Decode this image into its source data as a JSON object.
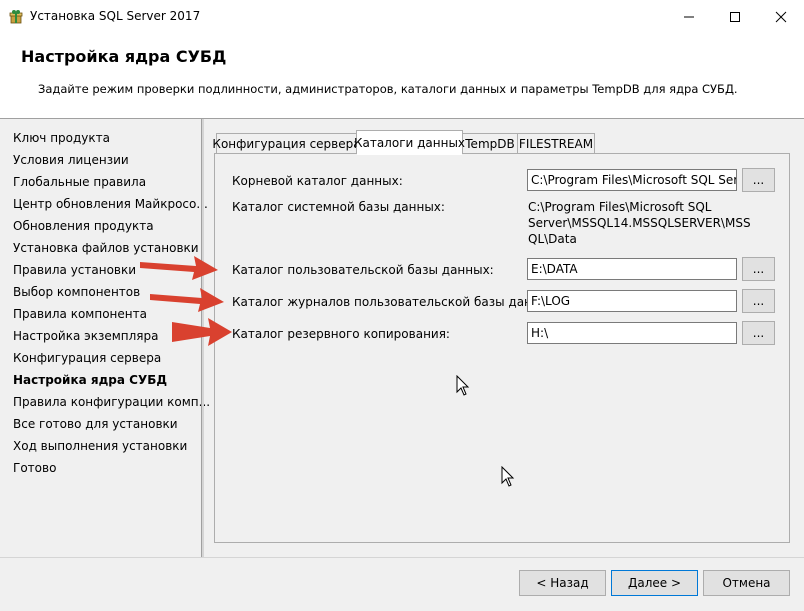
{
  "window": {
    "title": "Установка SQL Server 2017",
    "minimize_icon": "minimize-icon",
    "maximize_icon": "maximize-icon",
    "close_icon": "close-icon"
  },
  "header": {
    "title": "Настройка ядра СУБД",
    "description": "Задайте режим проверки подлинности, администраторов, каталоги данных и параметры TempDB для ядра СУБД."
  },
  "sidebar": {
    "items": [
      {
        "label": "Ключ продукта"
      },
      {
        "label": "Условия лицензии"
      },
      {
        "label": "Глобальные правила"
      },
      {
        "label": "Центр обновления Майкросо..."
      },
      {
        "label": "Обновления продукта"
      },
      {
        "label": "Установка файлов установки"
      },
      {
        "label": "Правила установки"
      },
      {
        "label": "Выбор компонентов"
      },
      {
        "label": "Правила компонента"
      },
      {
        "label": "Настройка экземпляра"
      },
      {
        "label": "Конфигурация сервера"
      },
      {
        "label": "Настройка ядра СУБД",
        "active": true
      },
      {
        "label": "Правила конфигурации комп..."
      },
      {
        "label": "Все готово для установки"
      },
      {
        "label": "Ход выполнения установки"
      },
      {
        "label": "Готово"
      }
    ]
  },
  "tabs": [
    {
      "label": "Конфигурация сервера"
    },
    {
      "label": "Каталоги данных",
      "selected": true
    },
    {
      "label": "TempDB"
    },
    {
      "label": "FILESTREAM"
    }
  ],
  "directories": {
    "root": {
      "label": "Корневой каталог данных:",
      "value": "C:\\Program Files\\Microsoft SQL Server\\"
    },
    "system_db": {
      "label": "Каталог системной базы данных:",
      "value_lines": [
        "C:\\Program Files\\Microsoft SQL",
        "Server\\MSSQL14.MSSQLSERVER\\MSS",
        "QL\\Data"
      ]
    },
    "user_db": {
      "label": "Каталог пользовательской базы данных:",
      "value": "E:\\DATA"
    },
    "user_log": {
      "label": "Каталог журналов пользовательской базы данных:",
      "value": "F:\\LOG"
    },
    "backup": {
      "label": "Каталог резервного копирования:",
      "value": "H:\\"
    },
    "browse_label": "..."
  },
  "buttons": {
    "back": "< Назад",
    "next": "Далее >",
    "cancel": "Отмена"
  },
  "colors": {
    "annotation_arrow": "#d9412f"
  }
}
